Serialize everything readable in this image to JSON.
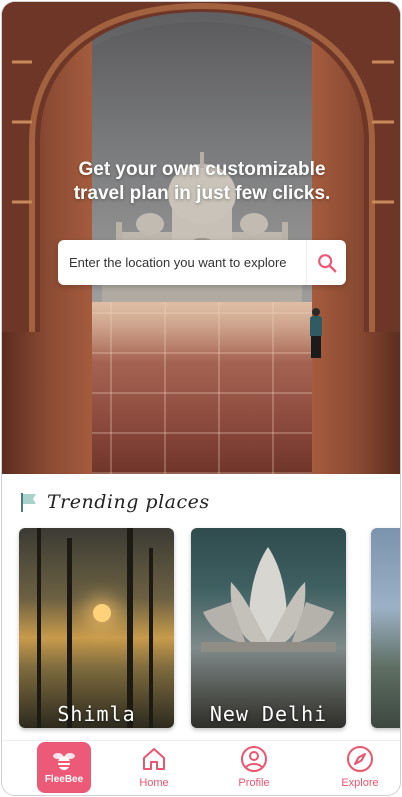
{
  "hero": {
    "title_line1": "Get your own customizable",
    "title_line2": "travel plan in just few clicks.",
    "search_placeholder": "Enter the location you want to explore"
  },
  "trending": {
    "title": "Trending places",
    "cards": [
      {
        "label": "Shimla"
      },
      {
        "label": "New Delhi"
      },
      {
        "label": ""
      }
    ]
  },
  "nav": {
    "logo_text": "FleeBee",
    "items": [
      {
        "label": "Home",
        "icon": "home-icon"
      },
      {
        "label": "Profile",
        "icon": "profile-icon"
      },
      {
        "label": "Explore",
        "icon": "compass-icon"
      }
    ],
    "accent": "#ec5a77"
  }
}
